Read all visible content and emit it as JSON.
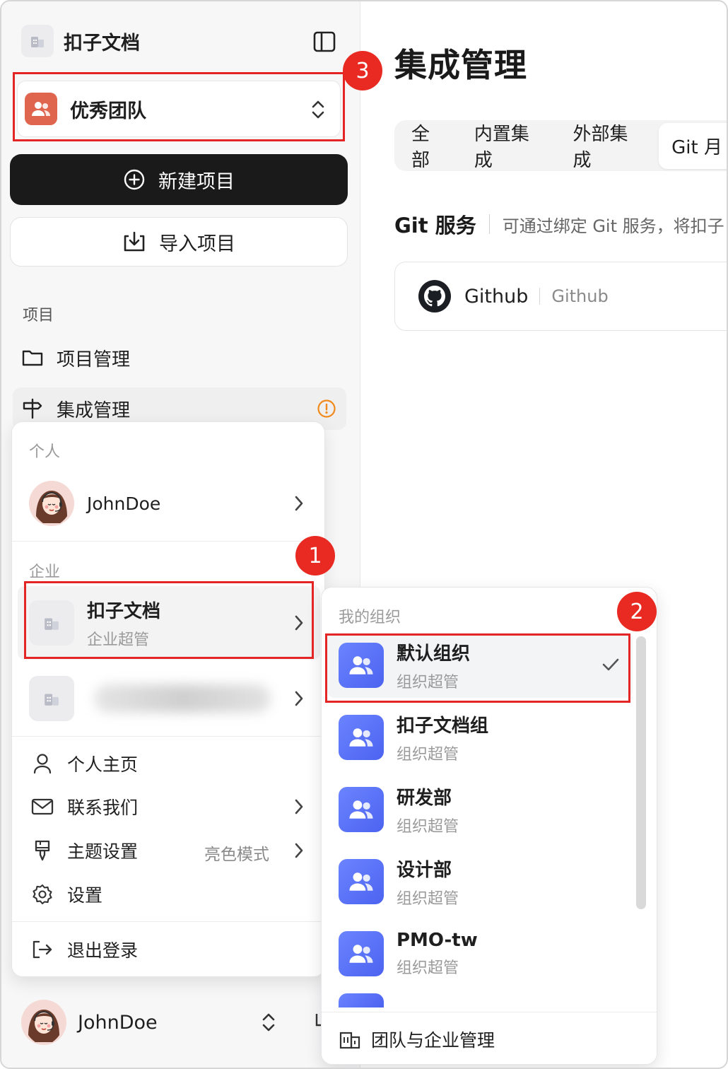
{
  "brand": {
    "name": "扣子文档",
    "logo_icon": "building-icon"
  },
  "team": {
    "name": "优秀团队",
    "avatar_color": "#e0654f"
  },
  "actions": {
    "new_project": "新建项目",
    "import_project": "导入项目"
  },
  "nav": {
    "section": "项目",
    "items": [
      {
        "label": "项目管理",
        "icon": "folder-icon"
      },
      {
        "label": "集成管理",
        "icon": "signpost-icon",
        "badge_icon": "warning-icon"
      }
    ]
  },
  "user": {
    "name": "JohnDoe"
  },
  "main": {
    "title": "集成管理",
    "tabs": [
      {
        "label": "全部"
      },
      {
        "label": "内置集成"
      },
      {
        "label": "外部集成"
      },
      {
        "label": "Git 月"
      }
    ],
    "git_section": {
      "heading": "Git 服务",
      "description": "可通过绑定 Git 服务，将扣子"
    },
    "providers": [
      {
        "name": "Github",
        "description": "Github"
      }
    ]
  },
  "account_menu": {
    "personal_label": "个人",
    "personal_user": "JohnDoe",
    "enterprise_label": "企业",
    "enterprises": [
      {
        "name": "扣子文档",
        "role": "企业超管"
      }
    ],
    "items": [
      {
        "label": "个人主页",
        "icon": "user-icon"
      },
      {
        "label": "联系我们",
        "icon": "mail-icon"
      },
      {
        "label": "主题设置",
        "icon": "brush-icon",
        "hint": "亮色模式"
      },
      {
        "label": "设置",
        "icon": "gear-icon"
      }
    ],
    "logout": "退出登录"
  },
  "org_menu": {
    "label": "我的组织",
    "orgs": [
      {
        "name": "默认组织",
        "role": "组织超管",
        "selected": true
      },
      {
        "name": "扣子文档组",
        "role": "组织超管"
      },
      {
        "name": "研发部",
        "role": "组织超管"
      },
      {
        "name": "设计部",
        "role": "组织超管"
      },
      {
        "name": "PMO-tw",
        "role": "组织超管"
      }
    ],
    "footer": "团队与企业管理"
  },
  "annotations": [
    "1",
    "2",
    "3"
  ],
  "colors": {
    "highlight": "#e32525",
    "badge": "#e82a22",
    "org_avatar": "#5b73f6"
  }
}
